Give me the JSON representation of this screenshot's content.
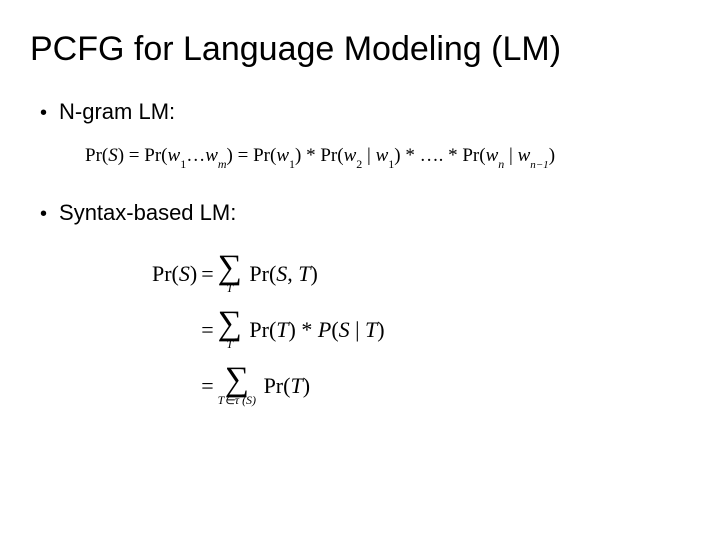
{
  "title": "PCFG for Language Modeling (LM)",
  "bullets": {
    "b1": "N-gram LM:",
    "b2": "Syntax-based LM:"
  },
  "formula_ngram": {
    "lhs1": "Pr(",
    "S": "S",
    "lhs2": ") = Pr(",
    "w": "w",
    "one": "1",
    "dots1": "…",
    "m": "m",
    "mid2": ") = Pr(",
    "close": ")",
    "star": " * ",
    "Pr_open": "Pr(",
    "two": "2",
    "bar": " | ",
    "ell": " * …. * ",
    "n": "n",
    "nminus1": "n−1"
  },
  "formula_syntax": {
    "lhs": "Pr(",
    "S": "S",
    "lhs_close": ")",
    "eq": "=",
    "sum_T": "T",
    "sum_TinTau": "T∈τ (S)",
    "rhs1a": "Pr(",
    "rhs1b": ", ",
    "T": "T",
    "rhs1c": ")",
    "rhs2a": "Pr(",
    "rhs2b": ") * ",
    "rhs2P": "P",
    "rhs2c": "(",
    "rhs2d": " | ",
    "rhs2e": ")",
    "rhs3a": "Pr(",
    "rhs3b": ")"
  }
}
